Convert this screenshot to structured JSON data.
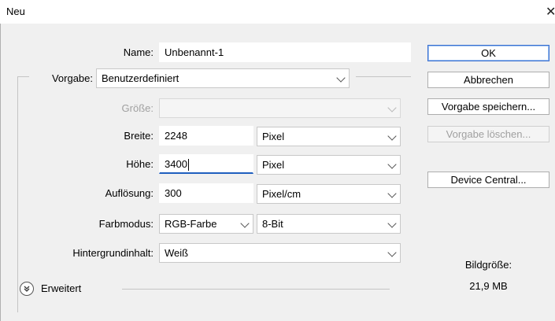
{
  "window": {
    "title": "Neu",
    "close_glyph": "✕"
  },
  "form": {
    "name_label": "Name:",
    "name_value": "Unbenannt-1",
    "preset_label": "Vorgabe:",
    "preset_value": "Benutzerdefiniert",
    "size_label": "Größe:",
    "size_value": "",
    "width_label": "Breite:",
    "width_value": "2248",
    "width_unit": "Pixel",
    "height_label": "Höhe:",
    "height_value": "3400",
    "height_unit": "Pixel",
    "resolution_label": "Auflösung:",
    "resolution_value": "300",
    "resolution_unit": "Pixel/cm",
    "colormode_label": "Farbmodus:",
    "colormode_value": "RGB-Farbe",
    "bitdepth_value": "8-Bit",
    "background_label": "Hintergrundinhalt:",
    "background_value": "Weiß",
    "advanced_label": "Erweitert",
    "advanced_icon": "double-chevron-down-icon"
  },
  "buttons": {
    "ok": "OK",
    "cancel": "Abbrechen",
    "save_preset": "Vorgabe speichern...",
    "delete_preset": "Vorgabe löschen...",
    "device_central": "Device Central..."
  },
  "info": {
    "image_size_label": "Bildgröße:",
    "image_size_value": "21,9 MB"
  },
  "colors": {
    "dialog_bg": "#f0f0f0",
    "focus_accent": "#1f5fbf",
    "default_button_border": "#3a6fd1",
    "disabled_text": "#a0a0a0"
  }
}
